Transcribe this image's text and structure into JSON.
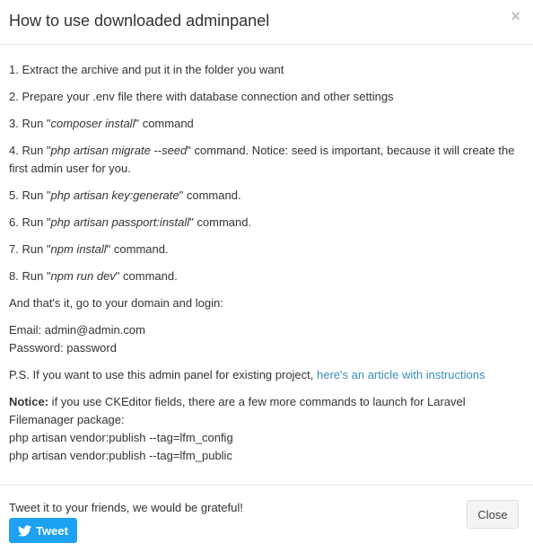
{
  "header": {
    "title": "How to use downloaded adminpanel",
    "close_glyph": "×"
  },
  "body": {
    "steps": [
      {
        "prefix": "1. Extract the archive and put it in the folder you want"
      },
      {
        "prefix": "2. Prepare your .env file there with database connection and other settings"
      },
      {
        "prefix": "3. Run \"",
        "cmd": "composer install",
        "suffix": "\" command"
      },
      {
        "prefix": "4. Run \"",
        "cmd": "php artisan migrate --seed",
        "suffix": "\" command. Notice: seed is important, because it will create the first admin user for you."
      },
      {
        "prefix": "5. Run \"",
        "cmd": "php artisan key:generate",
        "suffix": "\" command."
      },
      {
        "prefix": "6. Run \"",
        "cmd": "php artisan passport:install",
        "suffix": "\" command."
      },
      {
        "prefix": "7. Run \"",
        "cmd": "npm install",
        "suffix": "\" command."
      },
      {
        "prefix": "8. Run \"",
        "cmd": "npm run dev",
        "suffix": "\" command."
      }
    ],
    "outro": "And that's it, go to your domain and login:",
    "email_line": "Email: admin@admin.com",
    "password_line": "Password: password",
    "ps_text": "P.S. If you want to use this admin panel for existing project, ",
    "ps_link": "here's an article with instructions",
    "notice_label": "Notice:",
    "notice_text": " if you use CKEditor fields, there are a few more commands to launch for Laravel Filemanager package:",
    "notice_cmd1": "php artisan vendor:publish --tag=lfm_config",
    "notice_cmd2": "php artisan vendor:publish --tag=lfm_public"
  },
  "footer": {
    "tweet_text": "Tweet it to your friends, we would be grateful!",
    "tweet_button": "Tweet",
    "close_button": "Close",
    "tweet_color": "#1da1f2",
    "link_color": "#3c8dbc"
  }
}
